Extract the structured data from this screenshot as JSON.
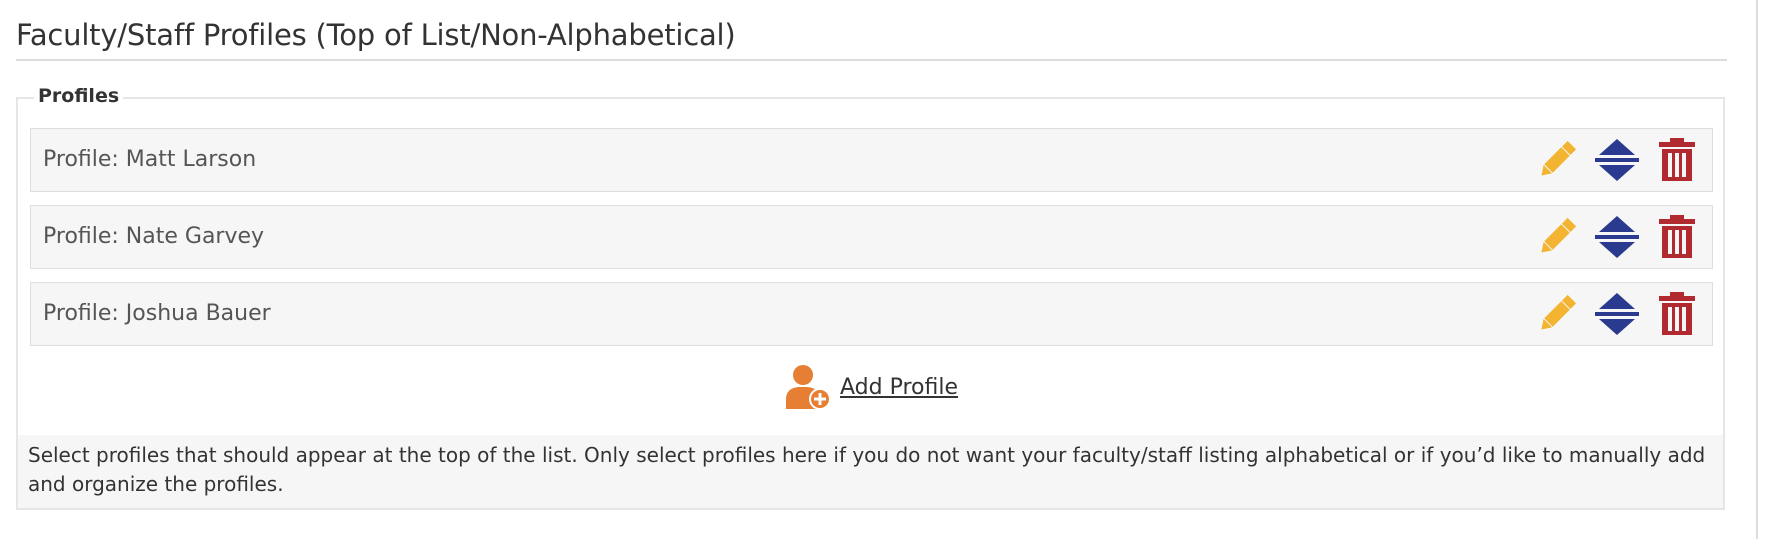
{
  "page": {
    "title": "Faculty/Staff Profiles (Top of List/Non-Alphabetical)"
  },
  "profiles_section": {
    "legend": "Profiles",
    "rows": [
      {
        "label": "Profile: Matt Larson"
      },
      {
        "label": "Profile: Nate Garvey"
      },
      {
        "label": "Profile: Joshua Bauer"
      }
    ],
    "actions": {
      "edit_icon": "pencil-icon",
      "move_icon": "reorder-arrows-icon",
      "delete_icon": "trash-icon"
    },
    "add_button": {
      "label": "Add Profile",
      "icon": "add-user-icon"
    },
    "help_text": "Select profiles that should appear at the top of the list. Only select profiles here if you do not want your faculty/staff listing alphabetical or if you’d like to manually add and organize the profiles."
  },
  "colors": {
    "edit": "#f2b431",
    "move": "#2a3b8f",
    "delete": "#b02a30",
    "add": "#e67e33"
  }
}
